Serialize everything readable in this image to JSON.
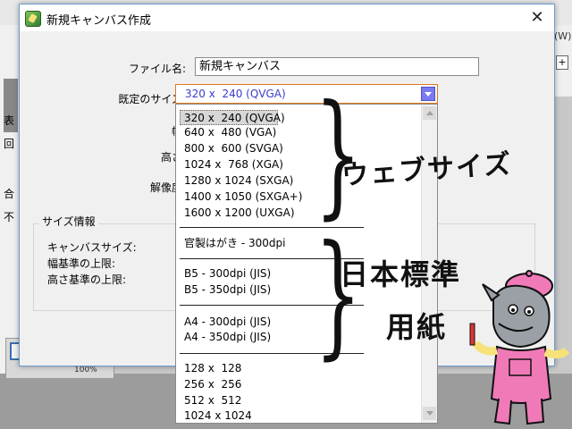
{
  "background": {
    "left_labels": [
      "表",
      "回",
      "合",
      "不"
    ],
    "right_tab_label": "(W)",
    "zoom_label": "100%"
  },
  "dialog": {
    "title": "新規キャンバス作成",
    "close_glyph": "✕",
    "labels": {
      "filename": "ファイル名:",
      "preset": "既定のサイズ:",
      "width": "幅:",
      "height": "高さ:",
      "resolution": "解像度:"
    },
    "filename_value": "新規キャンバス",
    "preset_value": "320 x  240 (QVGA)",
    "size_info": {
      "title": "サイズ情報",
      "rows": [
        "キャンバスサイズ:",
        "幅基準の上限:",
        "高さ基準の上限:"
      ]
    }
  },
  "dropdown": {
    "items": [
      "320 x  240 (QVGA)",
      "640 x  480 (VGA)",
      "800 x  600 (SVGA)",
      "1024 x  768 (XGA)",
      "1280 x 1024 (SXGA)",
      "1400 x 1050 (SXGA+)",
      "1600 x 1200 (UXGA)",
      "官製はがき - 300dpi",
      "B5 - 300dpi (JIS)",
      "B5 - 350dpi (JIS)",
      "A4 - 300dpi (JIS)",
      "A4 - 350dpi (JIS)",
      "128 x  128",
      "256 x  256",
      "512 x  512",
      "1024 x 1024"
    ],
    "selected_index": 0
  },
  "annotations": {
    "web_sizes": "ウェブサイズ",
    "jp_standard_line1": "日本標準",
    "jp_standard_line2": "用紙"
  },
  "colors": {
    "accent_border": "#e0781c",
    "select_text": "#3c3cc8",
    "dialog_border": "#6b9bd0",
    "mascot_pink": "#f07ab8",
    "mascot_gray": "#9aa0a6"
  }
}
